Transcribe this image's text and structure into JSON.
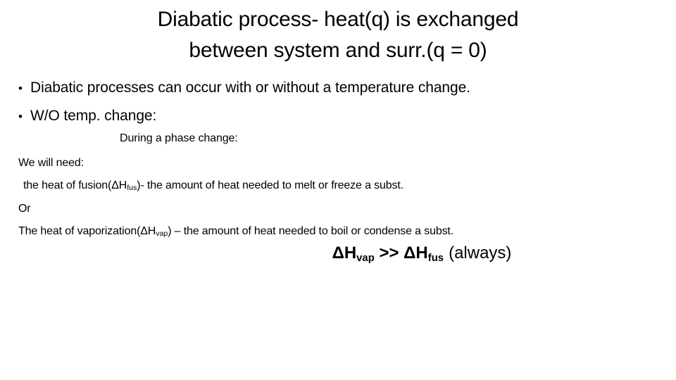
{
  "slide": {
    "background_color": "#ffffff",
    "text_color": "#000000",
    "title": {
      "line1": "Diabatic process- heat(q) is exchanged",
      "line2": "between system and surr.(q = 0)"
    },
    "bullets": [
      {
        "marker": "•",
        "text": "Diabatic processes can occur with or without a temperature change."
      },
      {
        "marker": "•",
        "text": "W/O temp. change:"
      }
    ],
    "phase_heading": "During a phase change:",
    "body_lines": [
      {
        "id": "we-will-need",
        "pre": "We will need:",
        "symbol": "",
        "subscript": "",
        "post": ""
      },
      {
        "id": "heat-of-fusion",
        "pre": "the heat of fusion(ΔH",
        "symbol": "",
        "subscript": "fus",
        "post": ")- the amount of heat needed to melt or freeze a subst."
      },
      {
        "id": "or",
        "pre": "Or",
        "symbol": "",
        "subscript": "",
        "post": ""
      },
      {
        "id": "heat-of-vaporization",
        "pre": "The heat of vaporization(ΔH",
        "symbol": "",
        "subscript": "vap",
        "post": ") – the amount of heat needed to boil or condense a subst."
      }
    ],
    "formula": {
      "term1_symbol": "ΔH",
      "term1_sub": "vap",
      "operator": " >> ",
      "term2_symbol": "ΔH",
      "term2_sub": "fus",
      "qualifier": "(always)"
    }
  }
}
